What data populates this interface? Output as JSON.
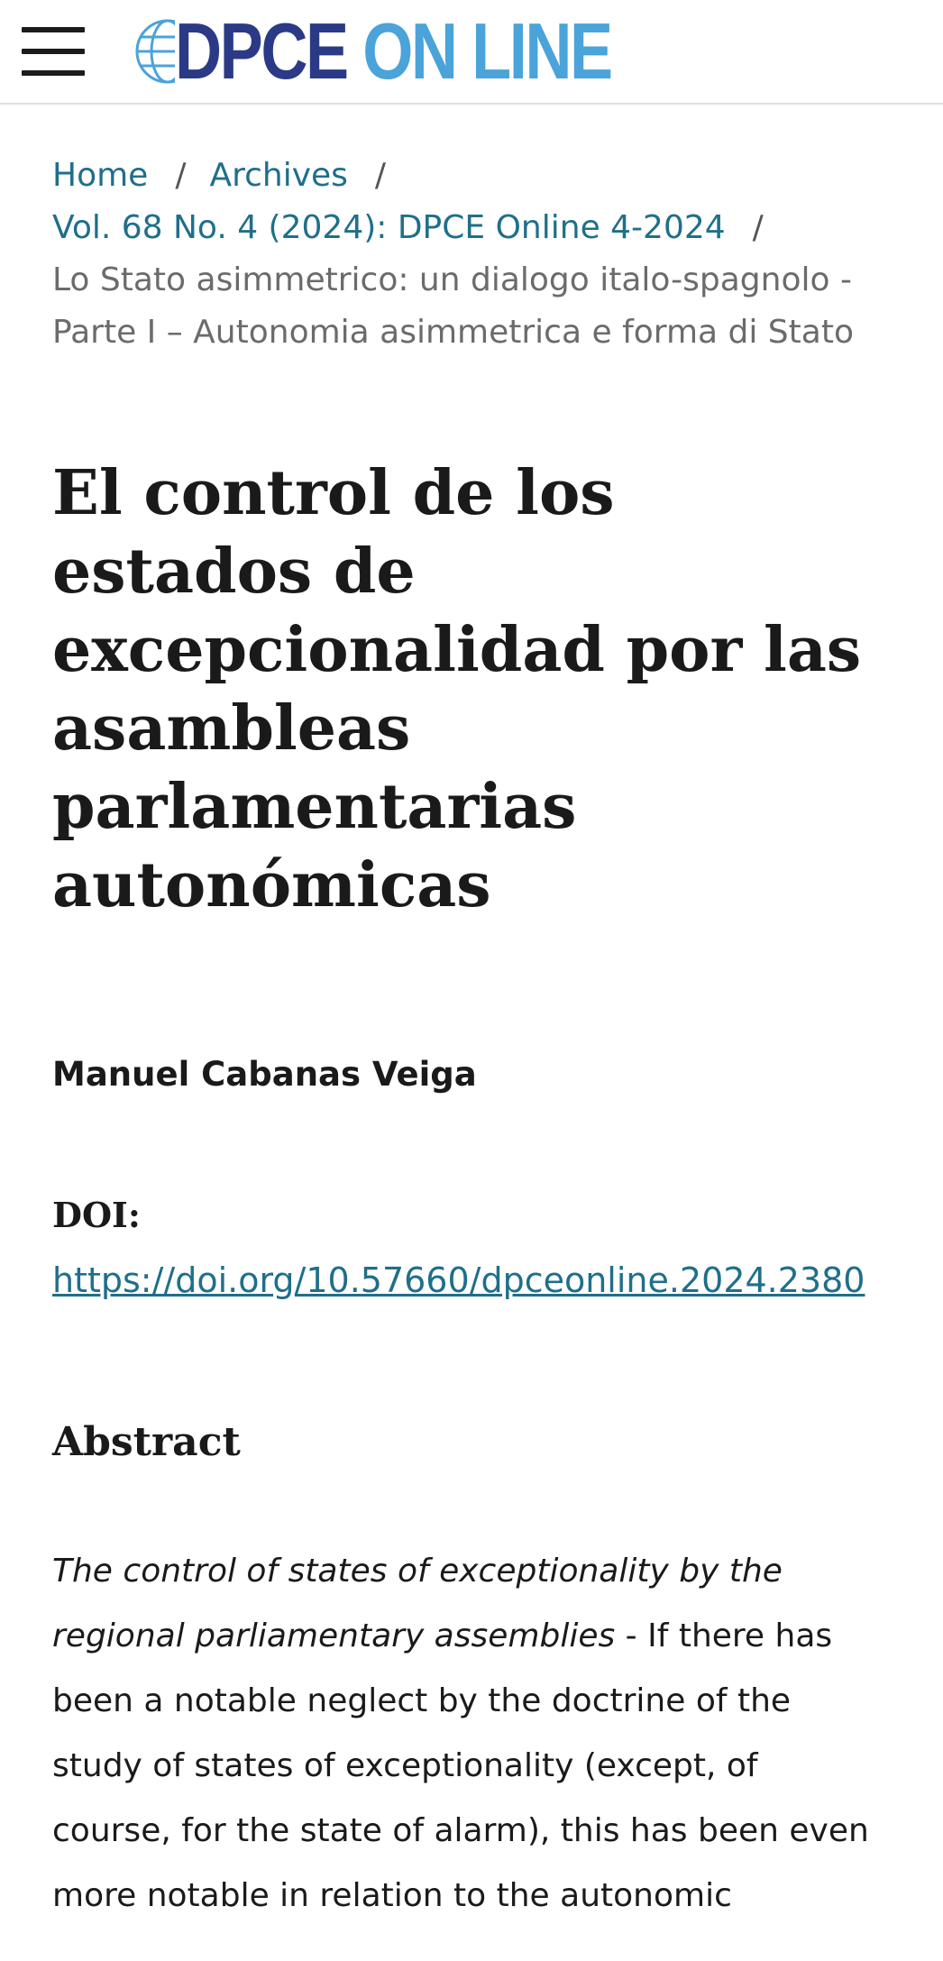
{
  "header": {
    "logo_left": "DPCE",
    "logo_right": "ON LINE"
  },
  "breadcrumb": {
    "home": "Home",
    "archives": "Archives",
    "issue": "Vol. 68 No. 4 (2024): DPCE Online 4-2024",
    "separator": "/",
    "current": "Lo Stato asimmetrico: un dialogo italo-spagnolo - Parte I – Autonomia asimmetrica e forma di Stato"
  },
  "article": {
    "title": "El control de los estados de excepcionalidad por las asambleas parlamentarias autonómicas",
    "author": "Manuel Cabanas Veiga",
    "doi_label": "DOI:",
    "doi_url": "https://doi.org/10.57660/dpceonline.2024.2380",
    "abstract_heading": "Abstract",
    "abstract_italic": "The control of states of exceptionality by the regional parliamentary assemblies",
    "abstract_body": " - If there has been a notable neglect by the doctrine of the study of states of exceptionality (except, of course, for the state of alarm), this has been even more notable in relation to the autonomic"
  }
}
